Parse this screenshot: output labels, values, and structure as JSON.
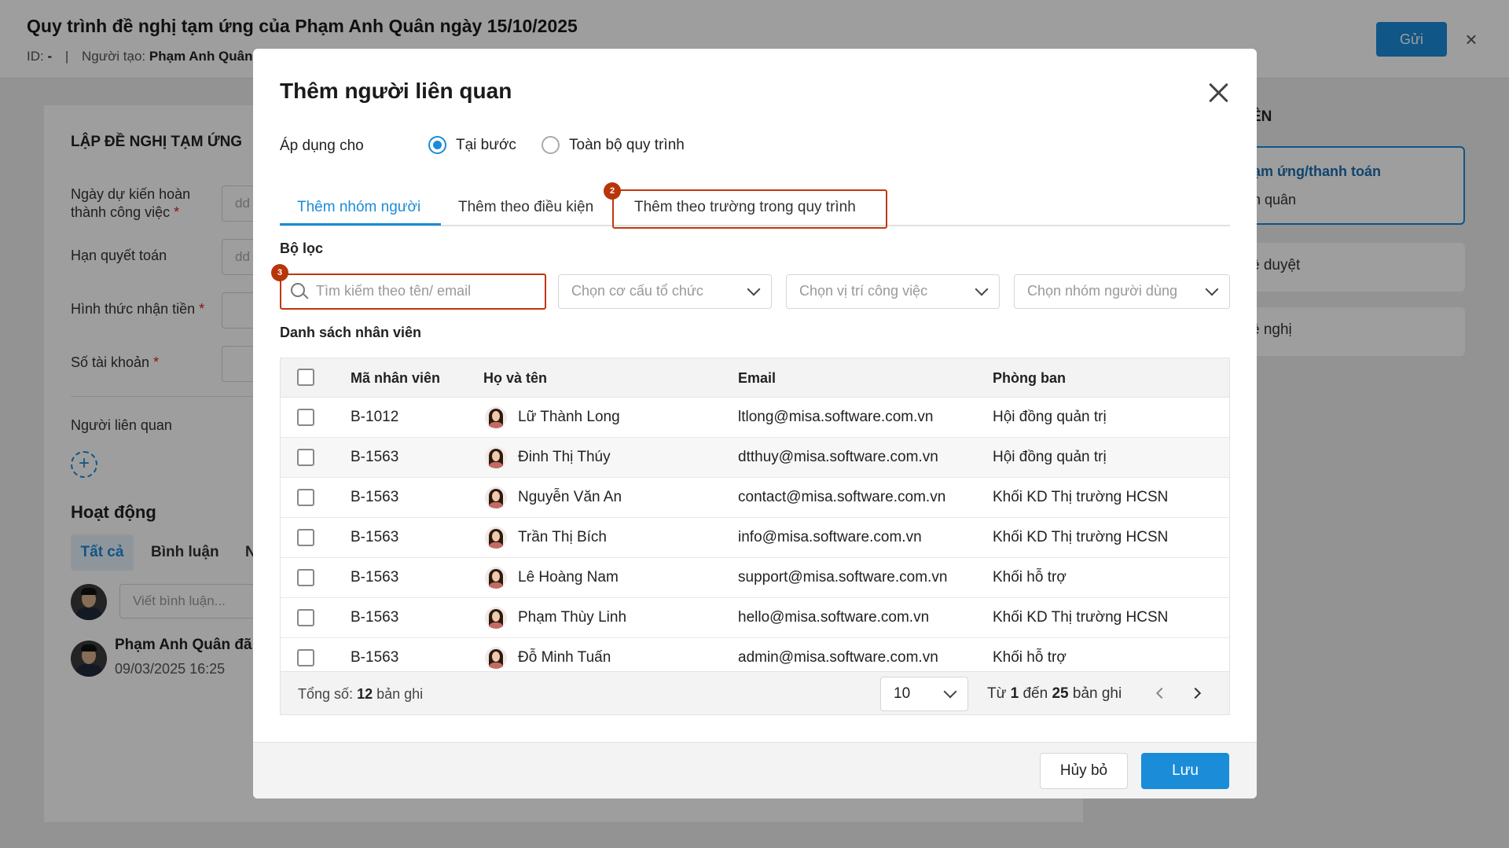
{
  "page": {
    "title": "Quy trình đề nghị tạm ứng của Phạm Anh Quân ngày 15/10/2025",
    "id_label": "ID:",
    "id_value": "-",
    "separator": "|",
    "creator_label": "Người tạo:",
    "creator_value": "Phạm Anh Quân",
    "send_button": "Gửi"
  },
  "form": {
    "heading": "LẬP ĐỀ NGHỊ TẠM ỨNG",
    "fields": [
      {
        "label": "Ngày dự kiến hoàn thành công việc",
        "required": true,
        "placeholder": "dd"
      },
      {
        "label": "Hạn quyết toán",
        "required": false,
        "placeholder": "dd"
      },
      {
        "label": "Hình thức nhận tiền",
        "required": true,
        "placeholder": ""
      },
      {
        "label": "Số tài khoản",
        "required": true,
        "placeholder": ""
      }
    ],
    "related_label": "Người liên quan",
    "add_symbol": "+"
  },
  "activity": {
    "title": "Hoạt động",
    "tabs": [
      "Tất cả",
      "Bình luận",
      "N"
    ],
    "comment_placeholder": "Viết bình luận...",
    "log_name": "Phạm Anh Quân đã",
    "log_time": "09/03/2025 16:25"
  },
  "right_panel": {
    "heading": "ÊN",
    "card_title": "ạm ứng/thanh toán",
    "card_sub": "h quân",
    "items": [
      "ê duyệt",
      "ề nghị"
    ]
  },
  "modal": {
    "title": "Thêm người liên quan",
    "apply_label": "Áp dụng cho",
    "radios": [
      {
        "label": "Tại bước",
        "checked": true
      },
      {
        "label": "Toàn bộ quy trình",
        "checked": false
      }
    ],
    "tabs": [
      {
        "label": "Thêm nhóm người",
        "active": true
      },
      {
        "label": "Thêm theo điều kiện",
        "active": false
      },
      {
        "label": "Thêm theo trường trong quy trình",
        "active": false
      }
    ],
    "badges": {
      "tab": "2",
      "search": "3"
    },
    "filter_label": "Bộ lọc",
    "search_placeholder": "Tìm kiếm theo tên/ email",
    "selects": [
      "Chọn cơ cấu tổ chức",
      "Chọn vị trí công việc",
      "Chọn nhóm người dùng"
    ],
    "list_label": "Danh sách nhân viên",
    "columns": [
      "Mã nhân viên",
      "Họ và tên",
      "Email",
      "Phòng ban"
    ],
    "rows": [
      {
        "code": "B-1012",
        "name": "Lữ Thành Long",
        "email": "ltlong@misa.software.com.vn",
        "dept": "Hội đồng quản trị"
      },
      {
        "code": "B-1563",
        "name": "Đinh Thị Thúy",
        "email": "dtthuy@misa.software.com.vn",
        "dept": "Hội đồng quản trị"
      },
      {
        "code": "B-1563",
        "name": "Nguyễn Văn An",
        "email": "contact@misa.software.com.vn",
        "dept": "Khối KD Thị trường HCSN"
      },
      {
        "code": "B-1563",
        "name": "Trần Thị Bích",
        "email": "info@misa.software.com.vn",
        "dept": "Khối KD Thị trường HCSN"
      },
      {
        "code": "B-1563",
        "name": "Lê Hoàng Nam",
        "email": "support@misa.software.com.vn",
        "dept": "Khối hỗ trợ"
      },
      {
        "code": "B-1563",
        "name": "Phạm Thùy Linh",
        "email": "hello@misa.software.com.vn",
        "dept": "Khối KD Thị trường HCSN"
      },
      {
        "code": "B-1563",
        "name": "Đỗ Minh Tuấn",
        "email": "admin@misa.software.com.vn",
        "dept": "Khối hỗ trợ"
      }
    ],
    "footer": {
      "total_label": "Tổng số:",
      "total_value": "12",
      "total_unit": "bản ghi",
      "page_size": "10",
      "range_from_label": "Từ",
      "range_from": "1",
      "range_to_label": "đến",
      "range_to": "25",
      "range_unit": "bản ghi"
    },
    "cancel_button": "Hủy bỏ",
    "save_button": "Lưu"
  },
  "colors": {
    "accent": "#1a8cd8",
    "highlight": "#c0360c",
    "badge": "#b8350a"
  }
}
